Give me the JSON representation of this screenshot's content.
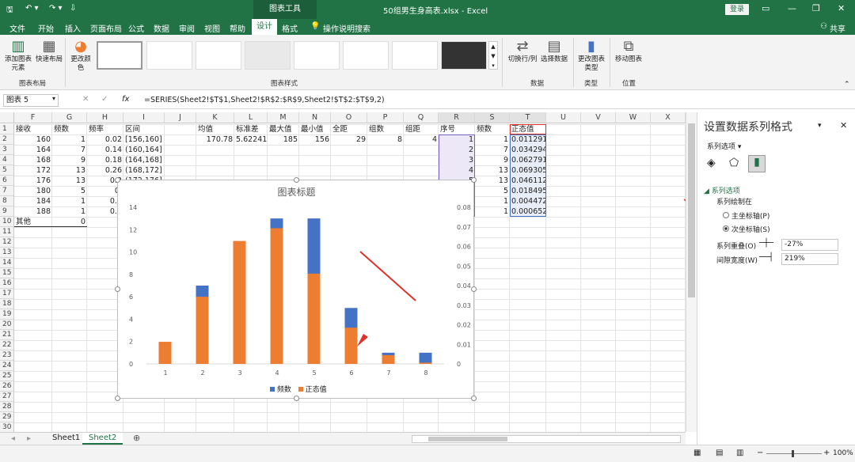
{
  "app": {
    "filename": "50组男生身高表.xlsx - Excel",
    "context_tool": "图表工具",
    "login_label": "登录",
    "share_label": "共享"
  },
  "menu": [
    "文件",
    "开始",
    "插入",
    "页面布局",
    "公式",
    "数据",
    "审阅",
    "视图",
    "帮助",
    "设计",
    "格式"
  ],
  "menu_active_index": 9,
  "tellme": "操作说明搜索",
  "ribbon": {
    "add_element": "添加图表元素",
    "quick_layout": "快速布局",
    "change_colors": "更改颜色",
    "group_layout": "图表布局",
    "group_styles": "图表样式",
    "switch_rowcol": "切换行/列",
    "select_data": "选择数据",
    "group_data": "数据",
    "change_type": "更改图表类型",
    "group_type": "类型",
    "move_chart": "移动图表",
    "group_location": "位置"
  },
  "formula": {
    "namebox": "图表 5",
    "fx": "fx",
    "content": "=SERIES(Sheet2!$T$1,Sheet2!$R$2:$R$9,Sheet2!$T$2:$T$9,2)"
  },
  "columns": [
    "F",
    "G",
    "H",
    "I",
    "J",
    "K",
    "L",
    "M",
    "N",
    "O",
    "P",
    "Q",
    "R",
    "S",
    "T",
    "U",
    "V",
    "W",
    "X"
  ],
  "rows": [
    "1",
    "2",
    "3",
    "4",
    "5",
    "6",
    "7",
    "8",
    "9",
    "10",
    "11",
    "12",
    "13",
    "14",
    "15",
    "16",
    "17",
    "18",
    "19",
    "20",
    "21",
    "22",
    "23",
    "24",
    "25",
    "26",
    "27",
    "28",
    "29",
    "30"
  ],
  "sheet": {
    "headers_left": [
      "接收",
      "频数",
      "频率",
      "区间"
    ],
    "left_rows": [
      [
        "160",
        "1",
        "0.02",
        "[156,160]"
      ],
      [
        "164",
        "7",
        "0.14",
        "(160,164]"
      ],
      [
        "168",
        "9",
        "0.18",
        "(164,168]"
      ],
      [
        "172",
        "13",
        "0.26",
        "(168,172]"
      ],
      [
        "176",
        "13",
        "0.2",
        "(172,176]"
      ],
      [
        "180",
        "5",
        "0.",
        ""
      ],
      [
        "184",
        "1",
        "0.0",
        ""
      ],
      [
        "188",
        "1",
        "0.0",
        ""
      ]
    ],
    "other_label": "其他",
    "other_value": "0",
    "stat_headers": [
      "均值",
      "标准差",
      "最大值",
      "最小值",
      "全距",
      "组数",
      "组距"
    ],
    "stat_values": [
      "170.78",
      "5.622419",
      "185",
      "156",
      "29",
      "8",
      "4"
    ],
    "right_headers": [
      "序号",
      "频数",
      "正态值"
    ],
    "right_rows": [
      [
        "1",
        "1",
        "0.011291"
      ],
      [
        "2",
        "7",
        "0.034294"
      ],
      [
        "3",
        "9",
        "0.062791"
      ],
      [
        "4",
        "13",
        "0.069305"
      ],
      [
        "5",
        "13",
        "0.046112"
      ],
      [
        "6",
        "5",
        "0.018495"
      ],
      [
        "7",
        "1",
        "0.004472"
      ],
      [
        "8",
        "1",
        "0.000652"
      ]
    ]
  },
  "chart_data": {
    "type": "bar",
    "title": "图表标题",
    "categories": [
      "1",
      "2",
      "3",
      "4",
      "5",
      "6",
      "7",
      "8"
    ],
    "series": [
      {
        "name": "频数",
        "values": [
          1,
          7,
          9,
          13,
          13,
          5,
          1,
          1
        ],
        "color": "#4472c4",
        "axis": "primary"
      },
      {
        "name": "正态值",
        "values": [
          0.011291,
          0.034294,
          0.062791,
          0.069305,
          0.046112,
          0.018495,
          0.004472,
          0.000652
        ],
        "color": "#ed7d31",
        "axis": "secondary"
      }
    ],
    "y_ticks": [
      "0",
      "2",
      "4",
      "6",
      "8",
      "10",
      "12",
      "14"
    ],
    "y2_ticks": [
      "0",
      "0.01",
      "0.02",
      "0.03",
      "0.04",
      "0.05",
      "0.06",
      "0.07",
      "0.08"
    ],
    "ylim": [
      0,
      14
    ],
    "y2lim": [
      0,
      0.08
    ],
    "legend_position": "bottom"
  },
  "tabs": [
    "Sheet1",
    "Sheet2"
  ],
  "active_tab": 1,
  "pane": {
    "title": "设置数据系列格式",
    "options_dropdown": "系列选项",
    "section": "系列选项",
    "plot_on": "系列绘制在",
    "primary": "主坐标轴(P)",
    "secondary": "次坐标轴(S)",
    "overlap_label": "系列重叠(O)",
    "overlap_value": "-27%",
    "gap_label": "间隙宽度(W)",
    "gap_value": "219%"
  },
  "status": {
    "zoom": "100%"
  }
}
